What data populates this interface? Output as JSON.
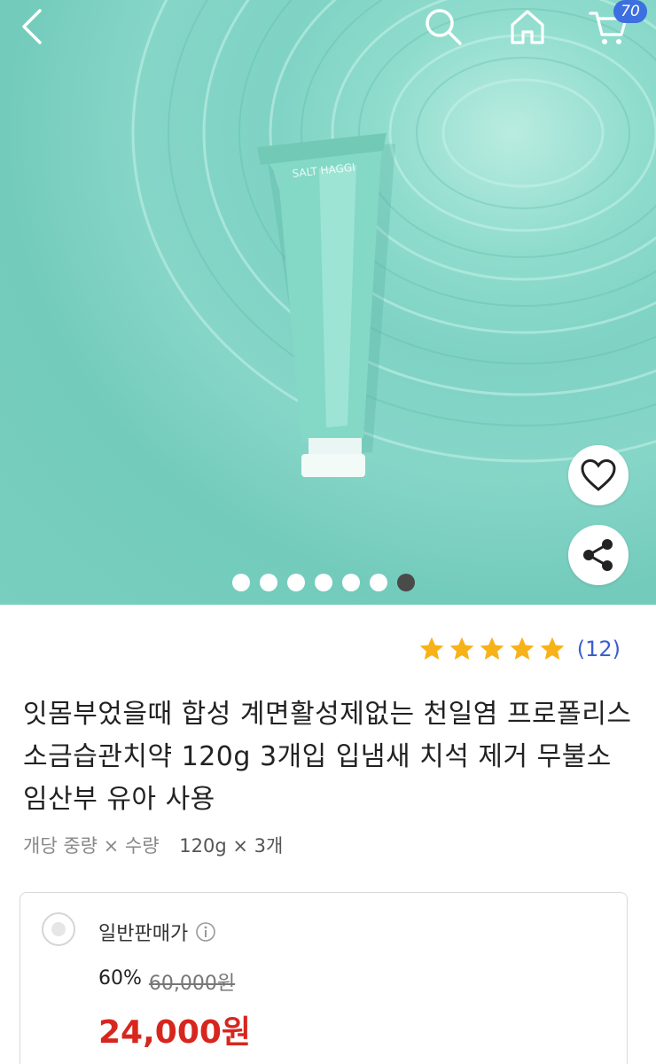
{
  "header": {
    "back_icon": "chevron-left-icon",
    "search_icon": "search-icon",
    "home_icon": "home-icon",
    "cart_icon": "cart-icon",
    "cart_count": "70"
  },
  "hero": {
    "product_brand": "SALT HAGGI",
    "image_count": 7,
    "active_index": 6
  },
  "actions": {
    "like_icon": "heart-icon",
    "share_icon": "share-icon"
  },
  "rating": {
    "stars": 5,
    "count_label": "(12)",
    "star_color": "#f7b21a"
  },
  "product": {
    "title": "잇몸부었을때 합성 계면활성제없는 천일염 프로폴리스 소금습관치약 120g 3개입 입냄새 치석 제거 무불소 임산부 유아 사용",
    "spec_label": "개당 중량 × 수량",
    "spec_value": "120g × 3개"
  },
  "pricing": {
    "type_label": "일반판매가",
    "discount_rate": "60%",
    "original_price": "60,000원",
    "sale_price": "24,000원",
    "sale_color": "#d7261e"
  }
}
